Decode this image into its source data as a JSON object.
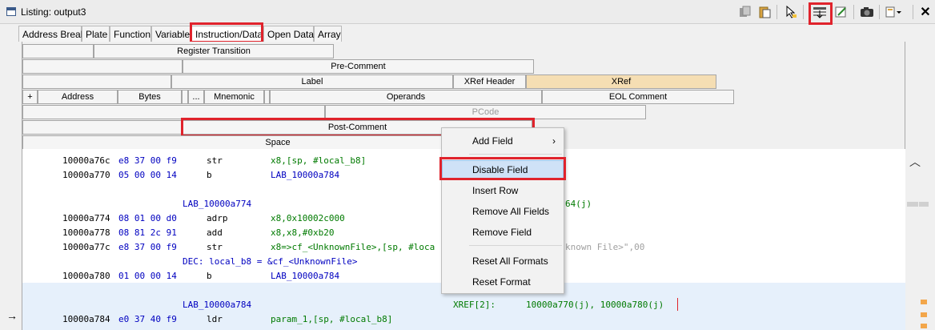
{
  "window": {
    "title": "Listing:  output3"
  },
  "tabs": [
    "Address Break",
    "Plate",
    "Function",
    "Variable",
    "Instruction/Data",
    "Open Data",
    "Array"
  ],
  "fields": {
    "row0": [
      "Register Transition"
    ],
    "row1": [
      "Pre-Comment"
    ],
    "row2": [
      "Label",
      "XRef Header",
      "XRef"
    ],
    "row3": [
      "+",
      "Address",
      "Bytes",
      "...",
      "Mnemonic",
      "Operands",
      "EOL Comment"
    ],
    "row4": [
      "PCode"
    ],
    "row5": [
      "Post-Comment"
    ],
    "row6": [
      "Space"
    ]
  },
  "listing": {
    "lines": [
      {
        "addr": "10000a76c",
        "bytes": "e8 37 00 f9",
        "mnem": "str",
        "ops": "x8,[sp, #local_b8]"
      },
      {
        "addr": "10000a770",
        "bytes": "05 00 00 14",
        "mnem": "b",
        "ops": "LAB_10000a784"
      },
      {
        "label": "LAB_10000a774",
        "xref_tail": "64(j)"
      },
      {
        "addr": "10000a774",
        "bytes": "08 01 00 d0",
        "mnem": "adrp",
        "ops": "x8,0x10002c000"
      },
      {
        "addr": "10000a778",
        "bytes": "08 81 2c 91",
        "mnem": "add",
        "ops": "x8,x8,#0xb20"
      },
      {
        "addr": "10000a77c",
        "bytes": "e8 37 00 f9",
        "mnem": "str",
        "ops": "x8=>cf_<UnknownFile>,[sp, #loca",
        "ops_tail": "known File>\",00"
      },
      {
        "dec": "DEC: local_b8 = &cf_<UnknownFile>"
      },
      {
        "addr": "10000a780",
        "bytes": "01 00 00 14",
        "mnem": "b",
        "ops": "LAB_10000a784"
      },
      {
        "label": "LAB_10000a784",
        "xref_label": "XREF[2]:",
        "xref_vals": "10000a770(j), 10000a780(j)"
      },
      {
        "addr": "10000a784",
        "bytes": "e0 37 40 f9",
        "mnem": "ldr",
        "ops": "param_1,[sp, #local_b8]"
      }
    ]
  },
  "context_menu": {
    "items": [
      "Add Field",
      "Disable Field",
      "Insert Row",
      "Remove All Fields",
      "Remove Field",
      "Reset All Formats",
      "Reset Format"
    ]
  },
  "icons": [
    "listing-window-icon",
    "copy-icon",
    "paste-icon",
    "cursor-icon",
    "field-header-icon",
    "edit-icon",
    "snapshot-icon",
    "menu-icon",
    "close-icon"
  ],
  "colors": {
    "highlight": "#e0232c",
    "selected_field": "#f5deb3",
    "menu_selected": "#cfe2f7"
  }
}
